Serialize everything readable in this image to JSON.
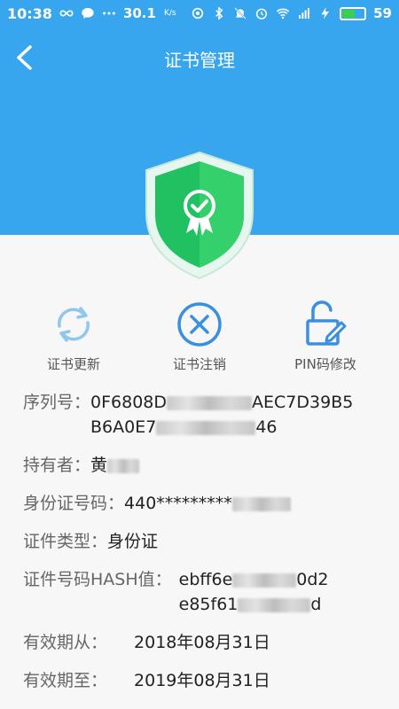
{
  "status_bar": {
    "time": "10:38",
    "net_speed": "30.1",
    "net_unit": "K/s",
    "battery_level": "59",
    "colors": {
      "background": "#37a6ee",
      "battery_fill": "#38d14a"
    }
  },
  "header": {
    "title": "证书管理",
    "colors": {
      "background": "#37a6ee"
    }
  },
  "actions": [
    {
      "label": "证书更新",
      "icon": "refresh-icon"
    },
    {
      "label": "证书注销",
      "icon": "close-circle-icon"
    },
    {
      "label": "PIN码修改",
      "icon": "unlock-edit-icon"
    }
  ],
  "info": {
    "serial_label": "序列号：",
    "serial_line1_a": "0F6808D",
    "serial_line1_b": "AEC7D39B5",
    "serial_line2_a": "B6A0E7",
    "serial_line2_b": "46",
    "holder_label": "持有者：",
    "holder_value": "黄",
    "idnum_label": "身份证号码：",
    "idnum_value": "440*********",
    "type_label": "证件类型：",
    "type_value": "身份证",
    "hash_label": "证件号码HASH值：",
    "hash_line1_a": "ebff6e",
    "hash_line1_b": "0d2",
    "hash_line2_a": "e85f61",
    "hash_line2_b": "d",
    "valid_from_label": "有效期从：",
    "valid_from_value": "2018年08月31日",
    "valid_to_label": "有效期至：",
    "valid_to_value": "2019年08月31日"
  }
}
